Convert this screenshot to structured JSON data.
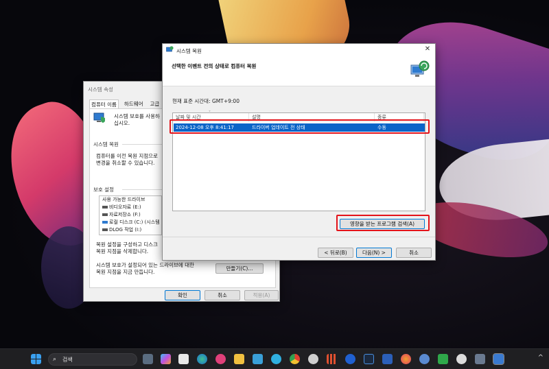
{
  "system_properties": {
    "title": "시스템 속성",
    "tabs": [
      "컴퓨터 이름",
      "하드웨어",
      "고급"
    ],
    "intro": [
      "시스템 보호를 사용하",
      "십시오."
    ],
    "restore_group": "시스템 복원",
    "restore_desc": [
      "컴퓨터를 이전 복원 지점으로",
      "변경을 취소할 수 있습니다."
    ],
    "protection_group": "보호 설정",
    "drive_header": "사용 가능한 드라이브",
    "drives": [
      "비디오자료 (E:)",
      "자료저장소 (F:)",
      "로컬 디스크 (C:) (시스템",
      "DLOG 작업 (I:)"
    ],
    "config_text": [
      "복원 설정을 구성하고 디스크",
      "복원 지점을 삭제합니다."
    ],
    "create_text": [
      "시스템 보호가 설정되어 있는 드라이브에 대한",
      "복원 지점을 지금 만듭니다."
    ],
    "create_btn": "만들기(C)...",
    "ok_btn": "확인",
    "cancel_btn": "취소",
    "apply_btn": "적용(A)"
  },
  "restore_wizard": {
    "title": "시스템 복원",
    "heading": "선택한 이벤트 전의 상태로 컴퓨터 복원",
    "timezone": "현재 표준 시간대: GMT+9:00",
    "columns": [
      "날짜 및 시간",
      "설명",
      "종류"
    ],
    "rows": [
      {
        "date": "2024-12-08 오후 8:41:17",
        "description": "드라이버 업데이트 전 상태",
        "type": "수동"
      }
    ],
    "scan_btn": "영향을 받는 프로그램 검색(A)",
    "back_btn": "< 뒤로(B)",
    "next_btn": "다음(N) >",
    "cancel_btn": "취소"
  },
  "taskbar": {
    "search_label": "검색",
    "icons": [
      "windows-start",
      "search",
      "app-1",
      "file-explorer-small",
      "copilot",
      "store",
      "edge",
      "flower-app",
      "file-explorer",
      "notepad",
      "bird-app",
      "chrome",
      "settings",
      "stripes-app",
      "check-app",
      "lightroom",
      "word",
      "firefox",
      "qb-app",
      "evernote",
      "obs",
      "user-app",
      "system-restore"
    ],
    "tray_chevron": "^"
  },
  "colors": {
    "selection": "#0a64c8",
    "highlight_box": "#e3131a",
    "taskbar_bg": "#1f1f22"
  }
}
